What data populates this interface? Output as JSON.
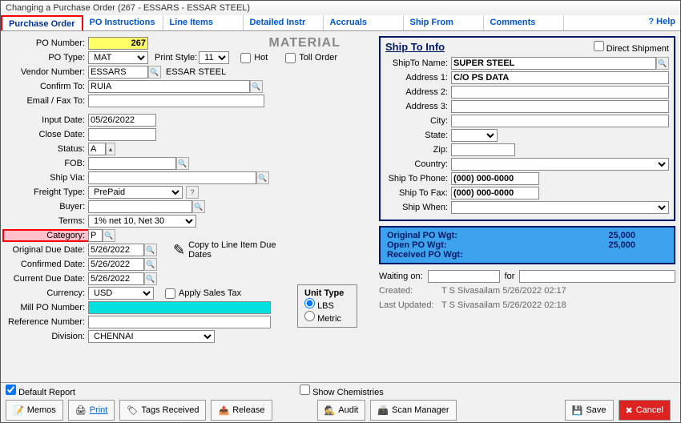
{
  "window": {
    "title": "Changing a Purchase Order  (267 - ESSARS -   ESSAR STEEL)"
  },
  "tabs": [
    "Purchase Order",
    "PO Instructions",
    "Line Items",
    "Detailed Instr",
    "Accruals",
    "Ship From",
    "Comments"
  ],
  "help": "Help",
  "header": {
    "material": "MATERIAL",
    "print_style_lbl": "Print Style:",
    "print_style": "11",
    "hot": "Hot",
    "toll": "Toll Order"
  },
  "labels": {
    "po_number": "PO Number:",
    "po_type": "PO Type:",
    "vendor_number": "Vendor Number:",
    "confirm_to": "Confirm To:",
    "email_fax": "Email / Fax To:",
    "input_date": "Input Date:",
    "close_date": "Close Date:",
    "status": "Status:",
    "fob": "FOB:",
    "ship_via": "Ship Via:",
    "freight_type": "Freight Type:",
    "buyer": "Buyer:",
    "terms": "Terms:",
    "category": "Category:",
    "orig_due": "Original Due Date:",
    "conf_date": "Confirmed Date:",
    "curr_due": "Current Due Date:",
    "currency": "Currency:",
    "apply_tax": "Apply Sales Tax",
    "mill_po": "Mill PO Number:",
    "ref_num": "Reference Number:",
    "division": "Division:",
    "copy": "Copy to Line Item Due Dates"
  },
  "values": {
    "po_number": "267",
    "po_type": "MAT",
    "vendor_number": "ESSARS",
    "vendor_name": "ESSAR STEEL",
    "confirm_to": "RUIA",
    "input_date": "05/26/2022",
    "close_date": "",
    "status": "A",
    "fob": "",
    "ship_via": "",
    "freight_type": "PrePaid",
    "buyer": "",
    "terms": "1% net 10, Net 30",
    "category": "P",
    "orig_due": "5/26/2022",
    "conf_date": "5/26/2022",
    "curr_due": "5/26/2022",
    "currency": "USD",
    "mill_po": "",
    "ref_num": "",
    "division": "CHENNAI"
  },
  "unit": {
    "title": "Unit Type",
    "lbs": "LBS",
    "metric": "Metric"
  },
  "shipto": {
    "title": "Ship To Info",
    "direct": "Direct Shipment",
    "labels": {
      "name": "ShipTo Name:",
      "addr1": "Address 1:",
      "addr2": "Address 2:",
      "addr3": "Address 3:",
      "city": "City:",
      "state": "State:",
      "zip": "Zip:",
      "country": "Country:",
      "phone": "Ship To Phone:",
      "fax": "Ship To Fax:",
      "when": "Ship When:"
    },
    "values": {
      "name": "SUPER STEEL",
      "addr1": "C/O PS DATA",
      "addr2": "",
      "addr3": "",
      "city": "",
      "state": "",
      "zip": "",
      "country": "",
      "phone": "(000) 000-0000",
      "fax": "(000) 000-0000",
      "when": ""
    }
  },
  "wgt": {
    "orig_lbl": "Original PO Wgt:",
    "open_lbl": "Open PO Wgt:",
    "recv_lbl": "Received PO Wgt:",
    "orig": "25,000",
    "open": "25,000",
    "recv": ""
  },
  "meta": {
    "waiting_lbl": "Waiting on:",
    "for_lbl": "for",
    "created_lbl": "Created:",
    "created": "T S Sivasailam 5/26/2022 02:17",
    "updated_lbl": "Last Updated:",
    "updated": "T S Sivasailam  5/26/2022 02:18"
  },
  "footer": {
    "default_report": "Default Report",
    "show_chem": "Show Chemistries",
    "memos": "Memos",
    "print": "Print",
    "tags": "Tags Received",
    "release": "Release",
    "audit": "Audit",
    "scan": "Scan Manager",
    "save": "Save",
    "cancel": "Cancel"
  }
}
